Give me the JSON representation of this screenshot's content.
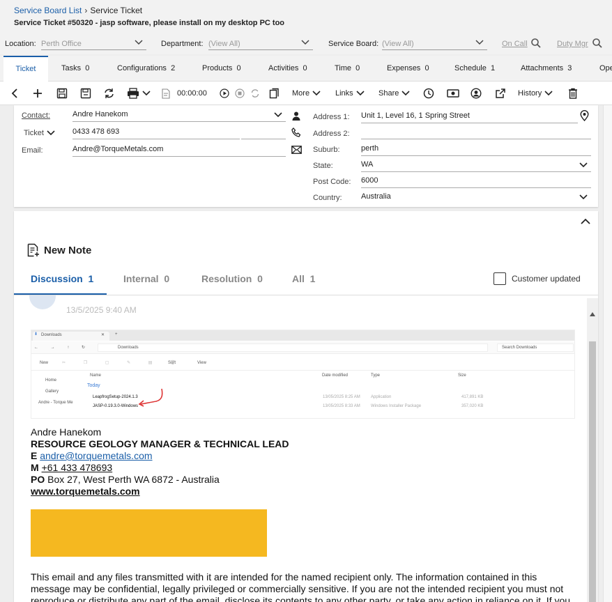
{
  "breadcrumb": {
    "parent": "Service Board List",
    "current": "Service Ticket"
  },
  "ticket_title": "Service Ticket #50320 - jasp software, please install on my desktop PC too",
  "filters": {
    "location_label": "Location:",
    "location_value": "Perth Office",
    "department_label": "Department:",
    "department_value": "(View All)",
    "board_label": "Service Board:",
    "board_value": "(View All)",
    "on_call": "On Call",
    "duty_mgr": "Duty Mgr"
  },
  "tabs": [
    {
      "label": "Ticket",
      "count": ""
    },
    {
      "label": "Tasks",
      "count": "0"
    },
    {
      "label": "Configurations",
      "count": "2"
    },
    {
      "label": "Products",
      "count": "0"
    },
    {
      "label": "Activities",
      "count": "0"
    },
    {
      "label": "Time",
      "count": "0"
    },
    {
      "label": "Expenses",
      "count": "0"
    },
    {
      "label": "Schedule",
      "count": "1"
    },
    {
      "label": "Attachments",
      "count": "3"
    },
    {
      "label": "Ope",
      "count": ""
    }
  ],
  "toolbar": {
    "timer": "00:00:00",
    "more": "More",
    "links": "Links",
    "share": "Share",
    "history": "History"
  },
  "contact": {
    "contact_label": "Contact:",
    "contact_value": "Andre Hanekom",
    "ticket_label": "Ticket",
    "phone_value": "0433 478 693",
    "email_label": "Email:",
    "email_value": "Andre@TorqueMetals.com"
  },
  "address": {
    "address1_label": "Address 1:",
    "address1_value": "Unit 1, Level 16, 1 Spring Street",
    "address2_label": "Address 2:",
    "address2_value": "",
    "suburb_label": "Suburb:",
    "suburb_value": "perth",
    "state_label": "State:",
    "state_value": "WA",
    "postcode_label": "Post Code:",
    "postcode_value": "6000",
    "country_label": "Country:",
    "country_value": "Australia"
  },
  "notes": {
    "new_note": "New Note",
    "tabs": [
      {
        "label": "Discussion",
        "count": "1"
      },
      {
        "label": "Internal",
        "count": "0"
      },
      {
        "label": "Resolution",
        "count": "0"
      },
      {
        "label": "All",
        "count": "1"
      }
    ],
    "customer_updated": "Customer updated",
    "timestamp": "13/5/2025 9:40 AM"
  },
  "screenshot": {
    "tab_title": "Downloads",
    "location": "Downloads",
    "search": "Search Downloads",
    "new": "New",
    "sort": "Sort",
    "view": "View",
    "col_name": "Name",
    "col_date": "Date modified",
    "col_type": "Type",
    "col_size": "Size",
    "group": "Today",
    "nav": [
      "Home",
      "Gallery",
      "Andre - Torque Me"
    ],
    "files": [
      {
        "name": "LeapfrogSetup-2024.1.3",
        "date": "13/05/2025 8:25 AM",
        "type": "Application",
        "size": "417,891 KB"
      },
      {
        "name": "JASP-0.19.3.0-Windows",
        "date": "13/05/2025 8:33 AM",
        "type": "Windows Installer Package",
        "size": "357,020 KB"
      }
    ]
  },
  "signature": {
    "name": "Andre Hanekom",
    "role": "RESOURCE GEOLOGY MANAGER & TECHNICAL LEAD",
    "e_label": "E",
    "email": "andre@torquemetals.com",
    "m_label": "M",
    "mobile": "+61 433 478693",
    "po_label": "PO",
    "po_rest": "Box 27, West Perth WA 6872 - Australia",
    "website": "www.torquemetals.com"
  },
  "disclaimer": "This email and any files transmitted with it are intended for the named recipient only. The information contained in this message may be confidential, legally privileged or commercially sensitive. If you are not the intended recipient you must not reproduce or distribute any part of the email, disclose its contents to any other party, or take any action in reliance on it. If you",
  "colors": {
    "accent": "#1a5ea8",
    "banner": "#f5b820"
  }
}
